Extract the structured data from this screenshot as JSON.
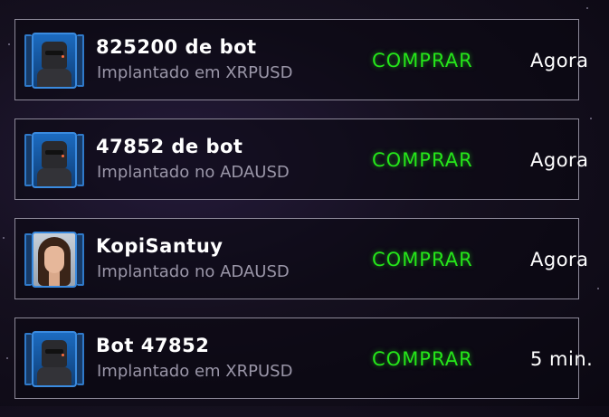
{
  "feed": {
    "items": [
      {
        "name": "825200 de bot",
        "subtitle": "Implantado em XRPUSD",
        "action": "COMPRAR",
        "time": "Agora",
        "avatar": "robot-avatar-icon"
      },
      {
        "name": "47852 de bot",
        "subtitle": "Implantado no ADAUSD",
        "action": "COMPRAR",
        "time": "Agora",
        "avatar": "robot-avatar-icon"
      },
      {
        "name": "KopiSantuy",
        "subtitle": "Implantado no ADAUSD",
        "action": "COMPRAR",
        "time": "Agora",
        "avatar": "user-avatar-icon"
      },
      {
        "name": "Bot 47852",
        "subtitle": "Implantado em XRPUSD",
        "action": "COMPRAR",
        "time": "5 min.",
        "avatar": "robot-avatar-icon"
      }
    ]
  },
  "colors": {
    "action": "#25e61a",
    "card_border": "#8c8898",
    "subtitle": "#9a96a8",
    "frame_blue": "#2f79c9"
  }
}
